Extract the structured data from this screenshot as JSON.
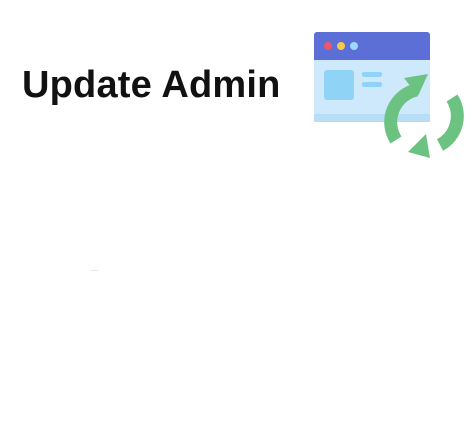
{
  "header": {
    "title": "Update Admin"
  },
  "illustration": {
    "icon": "browser-window-refresh-icon",
    "colors": {
      "window_bar": "#5b6fd6",
      "window_body": "#cde9fb",
      "window_card": "#8fd3f6",
      "window_lines": "#8fd3f6",
      "dot_red": "#f0566a",
      "dot_yellow": "#f6c94a",
      "dot_blue": "#9fd8ff",
      "refresh_arrows": "#6cc281"
    }
  }
}
